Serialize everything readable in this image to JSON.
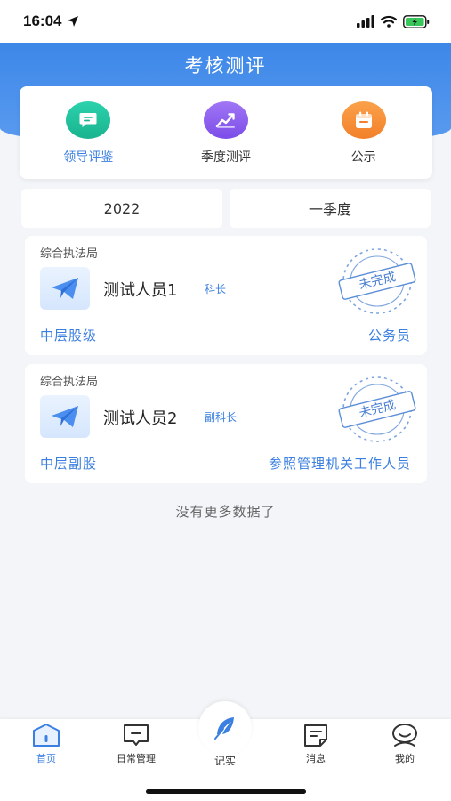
{
  "status_bar": {
    "time": "16:04"
  },
  "header": {
    "title": "考核测评"
  },
  "menu": [
    {
      "label": "领导评鉴",
      "icon": "message-icon",
      "color": "#1dbf9c",
      "active": true
    },
    {
      "label": "季度测评",
      "icon": "chart-icon",
      "color": "#8b5cf0",
      "active": false
    },
    {
      "label": "公示",
      "icon": "calendar-icon",
      "color": "#f5913b",
      "active": false
    }
  ],
  "filters": {
    "year": "2022",
    "quarter": "一季度"
  },
  "records": [
    {
      "department": "综合执法局",
      "name": "测试人员1",
      "title": "科长",
      "level": "中层股级",
      "type": "公务员",
      "stamp": "未完成"
    },
    {
      "department": "综合执法局",
      "name": "测试人员2",
      "title": "副科长",
      "level": "中层副股",
      "type": "参照管理机关工作人员",
      "stamp": "未完成"
    }
  ],
  "footer_note": "没有更多数据了",
  "tabs": [
    {
      "label": "首页",
      "icon": "home-icon",
      "active": true
    },
    {
      "label": "日常管理",
      "icon": "message-square-icon",
      "active": false
    },
    {
      "label": "记实",
      "icon": "feather-icon",
      "active": false
    },
    {
      "label": "消息",
      "icon": "document-icon",
      "active": false
    },
    {
      "label": "我的",
      "icon": "user-icon",
      "active": false
    }
  ],
  "colors": {
    "primary": "#3b7fe0",
    "header": "#4a8eea",
    "background": "#f3f5f8"
  }
}
